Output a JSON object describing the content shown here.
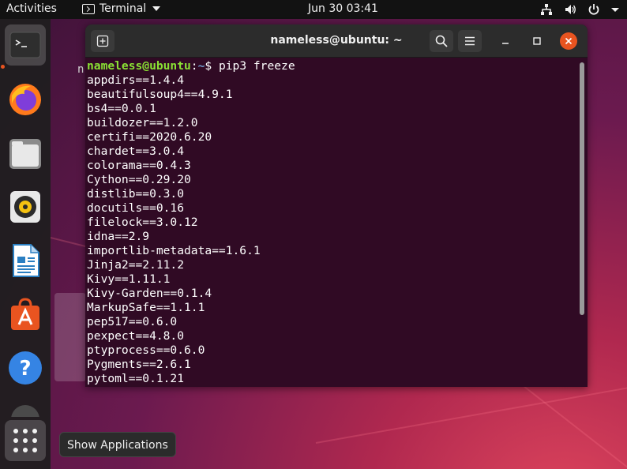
{
  "topbar": {
    "activities": "Activities",
    "app_name": "Terminal",
    "clock": "Jun 30  03:41",
    "icons": [
      "network-icon",
      "volume-icon",
      "power-icon",
      "menu-caret-icon"
    ]
  },
  "dock": {
    "items": [
      {
        "name": "terminal",
        "icon": "terminal-icon",
        "active": true
      },
      {
        "name": "firefox",
        "icon": "firefox-icon"
      },
      {
        "name": "files",
        "icon": "files-icon"
      },
      {
        "name": "rhythmbox",
        "icon": "rhythmbox-icon"
      },
      {
        "name": "writer",
        "icon": "libreoffice-writer-icon"
      },
      {
        "name": "software",
        "icon": "ubuntu-software-icon"
      },
      {
        "name": "help",
        "icon": "help-icon"
      }
    ],
    "show_apps_icon": "grid-icon"
  },
  "tooltip": {
    "text": "Show Applications"
  },
  "desktop": {
    "partial_label": "n"
  },
  "terminal": {
    "title": "nameless@ubuntu: ~",
    "prompt_user": "nameless@ubuntu",
    "prompt_sep": ":",
    "prompt_path": "~",
    "prompt_symbol": "$ ",
    "command": "pip3 freeze",
    "output": [
      "appdirs==1.4.4",
      "beautifulsoup4==4.9.1",
      "bs4==0.0.1",
      "buildozer==1.2.0",
      "certifi==2020.6.20",
      "chardet==3.0.4",
      "colorama==0.4.3",
      "Cython==0.29.20",
      "distlib==0.3.0",
      "docutils==0.16",
      "filelock==3.0.12",
      "idna==2.9",
      "importlib-metadata==1.6.1",
      "Jinja2==2.11.2",
      "Kivy==1.11.1",
      "Kivy-Garden==0.1.4",
      "MarkupSafe==1.1.1",
      "pep517==0.6.0",
      "pexpect==4.8.0",
      "ptyprocess==0.6.0",
      "Pygments==2.6.1",
      "pytoml==0.1.21"
    ]
  },
  "colors": {
    "terminal_bg": "#300a24",
    "prompt_user": "#8ae234",
    "prompt_path": "#729fcf",
    "close_button": "#e95420",
    "dock_bg": "#1e1e1e"
  }
}
